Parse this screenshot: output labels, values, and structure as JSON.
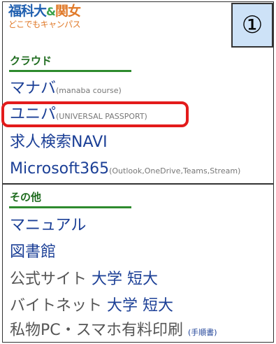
{
  "logo": {
    "part1": "福科大",
    "amp": "&",
    "part2": "関女",
    "subtitle": "どこでもキャンパス"
  },
  "badge": "①",
  "sections": [
    {
      "title": "クラウド",
      "links": [
        {
          "label": "マナバ",
          "note": "(manaba course)"
        },
        {
          "label": "ユニパ",
          "note": "(UNIVERSAL PASSPORT)"
        },
        {
          "label": "求人検索NAVI",
          "note": ""
        },
        {
          "label": "Microsoft365",
          "note": "(Outlook,OneDrive,Teams,Stream)"
        }
      ]
    },
    {
      "title": "その他",
      "links": [
        {
          "label": "マニュアル"
        },
        {
          "label": "図書館"
        },
        {
          "label": "公式サイト",
          "tags": [
            "大学",
            "短大"
          ]
        },
        {
          "label": "バイトネット",
          "tags": [
            "大学",
            "短大"
          ]
        },
        {
          "label": "私物PC・スマホ有料印刷",
          "note": "(手順書)"
        }
      ]
    }
  ]
}
